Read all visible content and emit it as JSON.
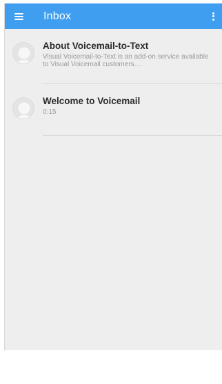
{
  "app_bar": {
    "title": "Inbox",
    "menu_icon": "hamburger-menu-icon",
    "overflow_icon": "more-vert-icon",
    "color": "#3f9ef0"
  },
  "messages": [
    {
      "title": "About Voicemail-to-Text",
      "subtitle": "Visual Voicemail-to-Text is an add-on service available to Visual Voicemail customers...."
    },
    {
      "title": "Welcome to Voicemail",
      "subtitle": "0:15"
    }
  ]
}
